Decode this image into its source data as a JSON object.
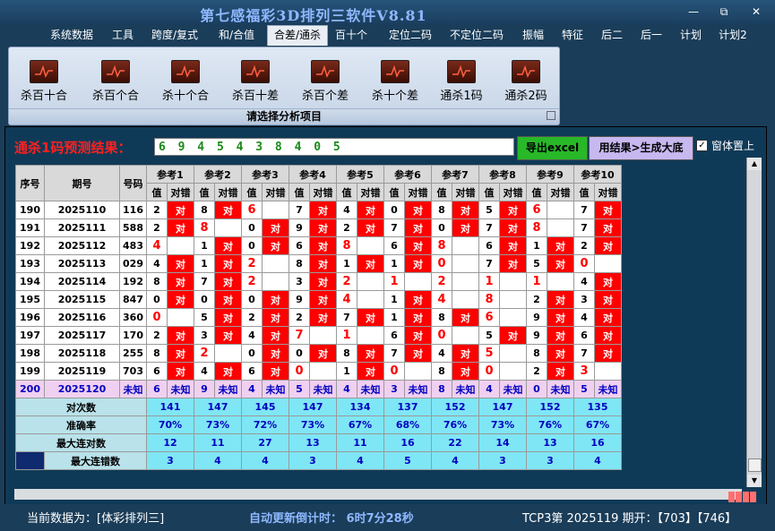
{
  "window": {
    "title": "第七感福彩3D排列三软件V8.81",
    "min_icon": "minimize-icon",
    "max_icon": "restore-icon",
    "close_icon": "close-icon"
  },
  "menu": [
    "系统数据",
    "工具",
    "跨度/复式",
    "和/合值",
    "合差/通杀",
    "百十个",
    "定位二码",
    "不定位二码",
    "振幅",
    "特征",
    "后二",
    "后一",
    "计划",
    "计划2"
  ],
  "menu_active": "合差/通杀",
  "ribbon": {
    "buttons": [
      "杀百十合",
      "杀百个合",
      "杀十个合",
      "杀百十差",
      "杀百个差",
      "杀十个差",
      "通杀1码",
      "通杀2码"
    ],
    "caption": "请选择分析项目"
  },
  "predict": {
    "label": "通杀1码预测结果：",
    "value": "6 9 4 5 4 3 8 4 0 5",
    "excel_btn": "导出excel",
    "gen_btn": "用结果>生成大底",
    "pin_label": "窗体置上"
  },
  "table": {
    "col_seq": "序号",
    "col_period": "期号",
    "col_num": "号码",
    "refs": [
      "参考1",
      "参考2",
      "参考3",
      "参考4",
      "参考5",
      "参考6",
      "参考7",
      "参考8",
      "参考9",
      "参考10"
    ],
    "sub_val": "值",
    "sub_hit": "对错",
    "rows": [
      {
        "seq": "190",
        "period": "2025110",
        "num": "116",
        "v": [
          "2",
          "8",
          "6",
          "7",
          "4",
          "0",
          "8",
          "5",
          "6",
          "7"
        ],
        "h": [
          1,
          1,
          0,
          1,
          1,
          1,
          1,
          1,
          0,
          1
        ],
        "r": [
          0,
          0,
          1,
          0,
          0,
          0,
          0,
          0,
          1,
          0
        ]
      },
      {
        "seq": "191",
        "period": "2025111",
        "num": "588",
        "v": [
          "2",
          "8",
          "0",
          "9",
          "2",
          "7",
          "0",
          "7",
          "8",
          "7"
        ],
        "h": [
          1,
          0,
          1,
          1,
          1,
          1,
          1,
          1,
          0,
          1
        ],
        "r": [
          0,
          1,
          0,
          0,
          0,
          0,
          0,
          0,
          1,
          0
        ]
      },
      {
        "seq": "192",
        "period": "2025112",
        "num": "483",
        "v": [
          "4",
          "1",
          "0",
          "6",
          "8",
          "6",
          "8",
          "6",
          "1",
          "2"
        ],
        "h": [
          0,
          1,
          1,
          1,
          0,
          1,
          0,
          1,
          1,
          1
        ],
        "r": [
          1,
          0,
          0,
          0,
          1,
          0,
          1,
          0,
          0,
          0
        ]
      },
      {
        "seq": "193",
        "period": "2025113",
        "num": "029",
        "v": [
          "4",
          "1",
          "2",
          "8",
          "1",
          "1",
          "0",
          "7",
          "5",
          "0"
        ],
        "h": [
          1,
          1,
          0,
          1,
          1,
          1,
          0,
          1,
          1,
          0
        ],
        "r": [
          0,
          0,
          1,
          0,
          0,
          0,
          1,
          0,
          0,
          1
        ]
      },
      {
        "seq": "194",
        "period": "2025114",
        "num": "192",
        "v": [
          "8",
          "7",
          "2",
          "3",
          "2",
          "1",
          "2",
          "1",
          "1",
          "4"
        ],
        "h": [
          1,
          1,
          0,
          1,
          0,
          0,
          0,
          0,
          0,
          1
        ],
        "r": [
          0,
          0,
          1,
          0,
          1,
          1,
          1,
          1,
          1,
          0
        ]
      },
      {
        "seq": "195",
        "period": "2025115",
        "num": "847",
        "v": [
          "0",
          "0",
          "0",
          "9",
          "4",
          "1",
          "4",
          "8",
          "2",
          "3"
        ],
        "h": [
          1,
          1,
          1,
          1,
          0,
          1,
          0,
          0,
          1,
          1
        ],
        "r": [
          0,
          0,
          0,
          0,
          1,
          0,
          1,
          1,
          0,
          0
        ]
      },
      {
        "seq": "196",
        "period": "2025116",
        "num": "360",
        "v": [
          "0",
          "5",
          "2",
          "2",
          "7",
          "1",
          "8",
          "6",
          "9",
          "4"
        ],
        "h": [
          0,
          1,
          1,
          1,
          1,
          1,
          1,
          0,
          1,
          1
        ],
        "r": [
          1,
          0,
          0,
          0,
          0,
          0,
          0,
          1,
          0,
          0
        ]
      },
      {
        "seq": "197",
        "period": "2025117",
        "num": "170",
        "v": [
          "2",
          "3",
          "4",
          "7",
          "1",
          "6",
          "0",
          "5",
          "9",
          "6"
        ],
        "h": [
          1,
          1,
          1,
          0,
          0,
          1,
          0,
          1,
          1,
          1
        ],
        "r": [
          0,
          0,
          0,
          1,
          1,
          0,
          1,
          0,
          0,
          0
        ]
      },
      {
        "seq": "198",
        "period": "2025118",
        "num": "255",
        "v": [
          "8",
          "2",
          "0",
          "0",
          "8",
          "7",
          "4",
          "5",
          "8",
          "7"
        ],
        "h": [
          1,
          0,
          1,
          1,
          1,
          1,
          1,
          0,
          1,
          1
        ],
        "r": [
          0,
          1,
          0,
          0,
          0,
          0,
          0,
          1,
          0,
          0
        ]
      },
      {
        "seq": "199",
        "period": "2025119",
        "num": "703",
        "v": [
          "6",
          "4",
          "6",
          "0",
          "1",
          "0",
          "8",
          "0",
          "2",
          "3"
        ],
        "h": [
          1,
          1,
          1,
          0,
          1,
          0,
          1,
          0,
          1,
          0
        ],
        "r": [
          0,
          0,
          0,
          1,
          0,
          1,
          0,
          1,
          0,
          1
        ]
      }
    ],
    "pred_row": {
      "seq": "200",
      "period": "2025120",
      "num": "未知",
      "v": [
        "6",
        "9",
        "4",
        "5",
        "4",
        "3",
        "8",
        "4",
        "0",
        "5"
      ],
      "hit_text": "未知"
    },
    "stats": [
      {
        "label": "对次数",
        "vals": [
          "141",
          "147",
          "145",
          "147",
          "134",
          "137",
          "152",
          "147",
          "152",
          "135"
        ]
      },
      {
        "label": "准确率",
        "vals": [
          "70%",
          "73%",
          "72%",
          "73%",
          "67%",
          "68%",
          "76%",
          "73%",
          "76%",
          "67%"
        ]
      },
      {
        "label": "最大连对数",
        "vals": [
          "12",
          "11",
          "27",
          "13",
          "11",
          "16",
          "22",
          "14",
          "13",
          "16"
        ]
      },
      {
        "label": "最大连错数",
        "vals": [
          "3",
          "4",
          "4",
          "3",
          "4",
          "5",
          "4",
          "3",
          "3",
          "4"
        ]
      }
    ],
    "hit_mark": "对"
  },
  "status": {
    "current_data": "当前数据为：[体彩排列三]",
    "countdown": "自动更新倒计时：  6时7分28秒",
    "draw_info": "TCP3第 2025119 期开：【703】【746】"
  }
}
